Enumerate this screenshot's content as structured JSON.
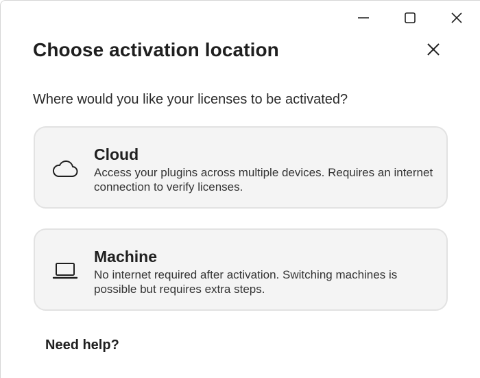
{
  "window": {
    "controls": {
      "minimize_icon": "minimize-icon",
      "maximize_icon": "maximize-icon",
      "close_icon": "close-icon"
    }
  },
  "dialog": {
    "title": "Choose activation location",
    "close_icon": "close-icon",
    "question": "Where would you like your licenses to be activated?",
    "options": [
      {
        "icon": "cloud-icon",
        "title": "Cloud",
        "description": "Access your plugins across multiple devices. Requires an internet connection to verify licenses."
      },
      {
        "icon": "laptop-icon",
        "title": "Machine",
        "description": "No internet required after activation. Switching machines is possible but requires extra steps."
      }
    ],
    "help_link": "Need help?"
  },
  "colors": {
    "text": "#1f1f1f",
    "card_background": "#f4f4f4",
    "card_border": "#e2e2e2"
  }
}
